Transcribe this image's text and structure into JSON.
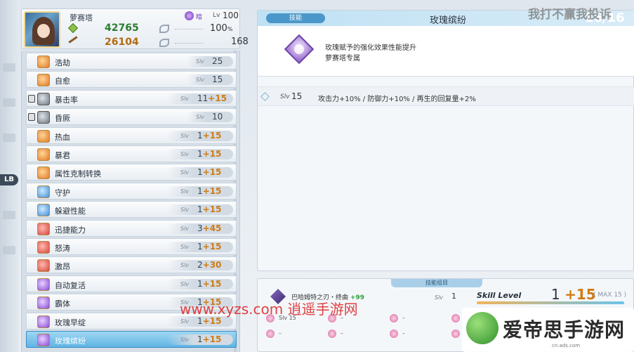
{
  "character": {
    "name": "萝赛塔",
    "level_label": "Lv",
    "level": "100",
    "hp": "42765",
    "atk": "26104",
    "percent": "100",
    "percent_suffix": "%",
    "stat2": "168"
  },
  "side_tag": "LB",
  "skills": [
    {
      "name": "浩劫",
      "slv_label": "Slv",
      "level": "25",
      "bonus": "",
      "icon": "sword-icon",
      "color": "orange",
      "locked": false
    },
    {
      "name": "自愈",
      "slv_label": "Slv",
      "level": "15",
      "bonus": "",
      "icon": "heal-icon",
      "color": "orange",
      "locked": false
    },
    {
      "name": "暴击率",
      "slv_label": "Slv",
      "level": "11",
      "bonus": "+15",
      "icon": "crit-icon",
      "color": "gray",
      "locked": true
    },
    {
      "name": "昏厥",
      "slv_label": "Slv",
      "level": "10",
      "bonus": "",
      "icon": "stun-icon",
      "color": "gray",
      "locked": true
    },
    {
      "name": "热血",
      "slv_label": "Slv",
      "level": "1",
      "bonus": "+15",
      "icon": "fist-icon",
      "color": "orange",
      "locked": false
    },
    {
      "name": "暴君",
      "slv_label": "Slv",
      "level": "1",
      "bonus": "+15",
      "icon": "tyrant-icon",
      "color": "orange",
      "locked": false
    },
    {
      "name": "属性克制转换",
      "slv_label": "Slv",
      "level": "1",
      "bonus": "+15",
      "icon": "star-icon",
      "color": "orange",
      "locked": false
    },
    {
      "name": "守护",
      "slv_label": "Slv",
      "level": "1",
      "bonus": "+15",
      "icon": "heart-icon",
      "color": "blue",
      "locked": false
    },
    {
      "name": "躲避性能",
      "slv_label": "Slv",
      "level": "1",
      "bonus": "+15",
      "icon": "evade-icon",
      "color": "blue",
      "locked": false
    },
    {
      "name": "迅捷能力",
      "slv_label": "Slv",
      "level": "3",
      "bonus": "+45",
      "icon": "speed-icon",
      "color": "red",
      "locked": false
    },
    {
      "name": "怒涛",
      "slv_label": "Slv",
      "level": "1",
      "bonus": "+15",
      "icon": "rage-icon",
      "color": "red",
      "locked": false
    },
    {
      "name": "激昂",
      "slv_label": "Slv",
      "level": "2",
      "bonus": "+30",
      "icon": "excite-icon",
      "color": "red",
      "locked": false
    },
    {
      "name": "自动复活",
      "slv_label": "Slv",
      "level": "1",
      "bonus": "+15",
      "icon": "revive-icon",
      "color": "purple",
      "locked": false
    },
    {
      "name": "霸体",
      "slv_label": "Slv",
      "level": "1",
      "bonus": "+15",
      "icon": "armor-icon",
      "color": "purple",
      "locked": false
    },
    {
      "name": "玫瑰早绽",
      "slv_label": "Slv",
      "level": "1",
      "bonus": "+15",
      "icon": "rose-icon",
      "color": "purple",
      "locked": false
    },
    {
      "name": "玫瑰缤纷",
      "slv_label": "Slv",
      "level": "1",
      "bonus": "+15",
      "icon": "rose-icon",
      "color": "purple",
      "locked": false,
      "selected": true
    }
  ],
  "detail": {
    "tag": "技能",
    "title": "玫瑰缤纷",
    "slv_label": "Slv",
    "slv_value": "16/16",
    "desc_line1": "玫瑰赋予的强化效果性能提升",
    "desc_line2": "萝赛塔专属",
    "level_slv_label": "Slv",
    "level_num": "15",
    "level_effect": "攻击力+10% / 防御力+10% / 再生的回复量+2%"
  },
  "top_watermark": "我打不赢我投诉",
  "bottom": {
    "group_tag": "技能组目",
    "weapon_name": "巴哈姆特之刃・终曲",
    "weapon_bonus": "+99",
    "slv_label": "Slv",
    "slv_num": "1",
    "skill_level_label": "Skill Level",
    "skill_level_base": "1",
    "skill_level_plus": "+15",
    "max_label": "( MAX 15 )",
    "skill_level_fraction": 1.0,
    "mini_rows": [
      [
        {
          "text": "Slv 15"
        },
        {
          "text": "–"
        },
        {
          "text": "–"
        },
        {
          "text": "–"
        }
      ],
      [
        {
          "text": "–"
        },
        {
          "text": "–"
        },
        {
          "text": "–"
        },
        {
          "text": "–"
        }
      ]
    ]
  },
  "site_watermark": "www.xyzs.com 逍遥手游网",
  "brand": {
    "text": "爱帝思手游网",
    "url": "cn.ads.com"
  }
}
